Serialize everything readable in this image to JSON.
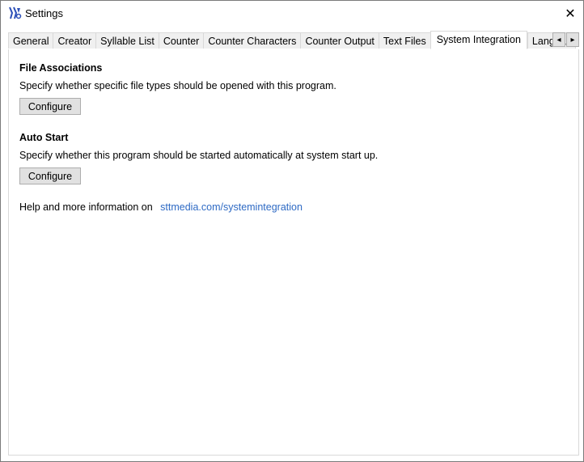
{
  "window": {
    "title": "Settings",
    "close_glyph": "✕"
  },
  "tabs": [
    {
      "label": "General",
      "active": false
    },
    {
      "label": "Creator",
      "active": false
    },
    {
      "label": "Syllable List",
      "active": false
    },
    {
      "label": "Counter",
      "active": false
    },
    {
      "label": "Counter Characters",
      "active": false
    },
    {
      "label": "Counter Output",
      "active": false
    },
    {
      "label": "Text Files",
      "active": false
    },
    {
      "label": "System Integration",
      "active": true
    },
    {
      "label": "Language",
      "active": false
    }
  ],
  "tab_scroll": {
    "left_glyph": "◂",
    "right_glyph": "▸"
  },
  "file_associations": {
    "title": "File Associations",
    "description": "Specify whether specific file types should be opened with this program.",
    "button_label": "Configure"
  },
  "auto_start": {
    "title": "Auto Start",
    "description": "Specify whether this program should be started automatically at system start up.",
    "button_label": "Configure"
  },
  "help": {
    "text": "Help and more information on",
    "link": "sttmedia.com/systemintegration"
  },
  "colors": {
    "link": "#2e6ac4",
    "button_bg": "#e1e1e1",
    "tab_bg": "#f0f0f0",
    "icon_blue": "#2b4fb8"
  }
}
